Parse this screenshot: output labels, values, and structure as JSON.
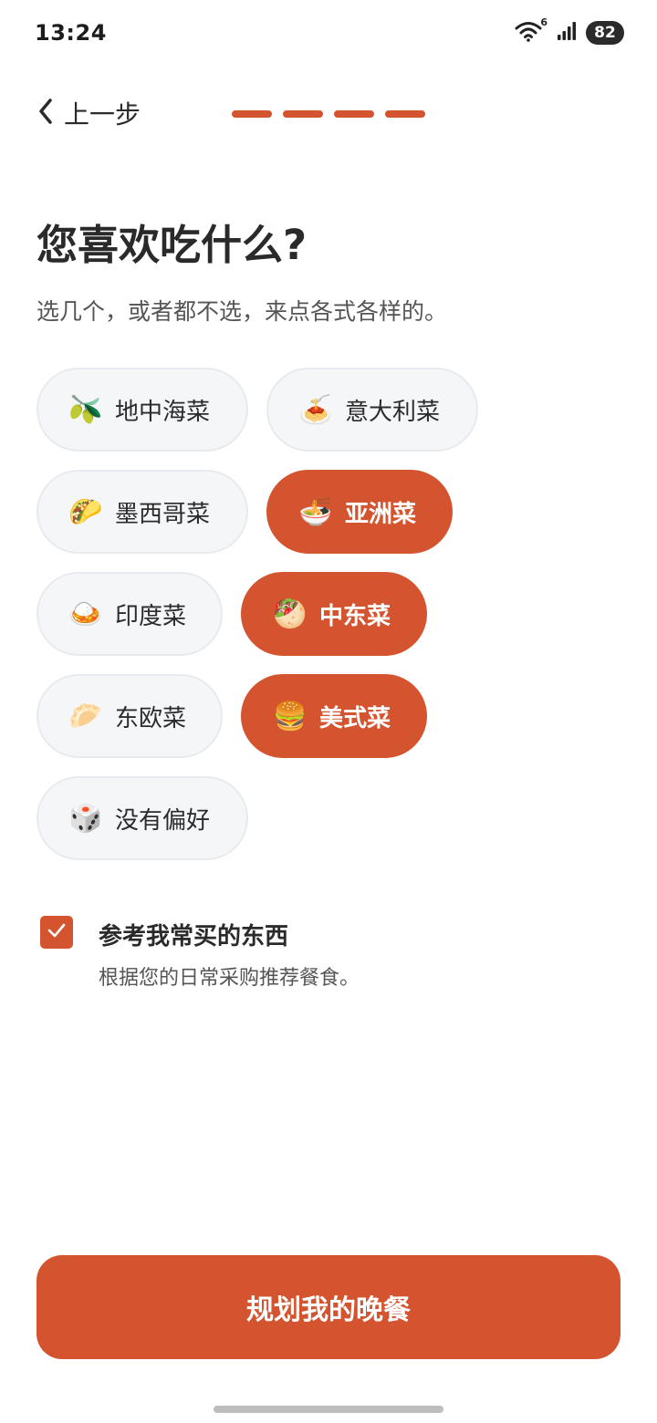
{
  "status": {
    "time": "13:24",
    "wifi_badge": "6",
    "battery": "82"
  },
  "header": {
    "back_label": "上一步",
    "progress": {
      "total_steps": 4,
      "completed_steps": 4,
      "color": "#d4542f"
    }
  },
  "main": {
    "title": "您喜欢吃什么?",
    "subtitle": "选几个，或者都不选，来点各式各样的。",
    "cuisines": [
      {
        "label": "地中海菜",
        "icon": "🫒",
        "icon_name": "olive-icon",
        "selected": false
      },
      {
        "label": "意大利菜",
        "icon": "🍝",
        "icon_name": "spaghetti-icon",
        "selected": false
      },
      {
        "label": "墨西哥菜",
        "icon": "🌮",
        "icon_name": "taco-icon",
        "selected": false
      },
      {
        "label": "亚洲菜",
        "icon": "🍜",
        "icon_name": "noodle-bowl-icon",
        "selected": true
      },
      {
        "label": "印度菜",
        "icon": "🍛",
        "icon_name": "curry-icon",
        "selected": false
      },
      {
        "label": "中东菜",
        "icon": "🥙",
        "icon_name": "flatbread-icon",
        "selected": true
      },
      {
        "label": "东欧菜",
        "icon": "🥟",
        "icon_name": "dumpling-icon",
        "selected": false
      },
      {
        "label": "美式菜",
        "icon": "🍔",
        "icon_name": "burger-icon",
        "selected": true
      },
      {
        "label": "没有偏好",
        "icon": "🎲",
        "icon_name": "dice-icon",
        "selected": false
      }
    ],
    "preference": {
      "checked": true,
      "title": "参考我常买的东西",
      "description": "根据您的日常采购推荐餐食。"
    }
  },
  "footer": {
    "cta_label": "规划我的晚餐"
  },
  "colors": {
    "accent": "#d4542f",
    "chip_bg": "#f4f6f8",
    "chip_border": "#e7ebef",
    "text": "#2a2a2a"
  }
}
